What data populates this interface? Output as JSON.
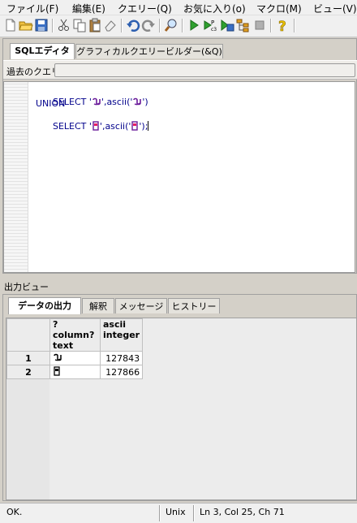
{
  "menu": {
    "items": [
      "ファイル(F)",
      "編集(E)",
      "クエリー(Q)",
      "お気に入り(o)",
      "マクロ(M)",
      "ビュー(V)"
    ]
  },
  "toolbar": {
    "icons": [
      "new-file-icon",
      "open-folder-icon",
      "save-icon",
      "cut-icon",
      "copy-icon",
      "paste-icon",
      "eraser-icon",
      "undo-icon",
      "redo-icon",
      "find-icon",
      "execute-icon",
      "explain-icon",
      "execute-to-file-icon",
      "explain-analyze-icon",
      "stop-icon",
      "help-icon"
    ]
  },
  "editor": {
    "tabs": [
      "SQLエディタ",
      "グラフィカルクエリービルダー(&Q)"
    ],
    "history_label": "過去のクエリ",
    "code": {
      "line1_pre": "SELECT '",
      "line1_mid": "',ascii('",
      "line1_post": "')",
      "line2": "UNION",
      "line3_pre": "SELECT '",
      "line3_mid": "',ascii('",
      "line3_post": "');"
    }
  },
  "output": {
    "label": "出力ビュー",
    "tabs": [
      "データの出力",
      "解釈",
      "メッセージ",
      "ヒストリー"
    ],
    "columns": [
      {
        "name": "?column?",
        "type": "text"
      },
      {
        "name": "ascii",
        "type": "integer"
      }
    ],
    "rows": [
      {
        "num": "1",
        "ascii": "127843"
      },
      {
        "num": "2",
        "ascii": "127866"
      }
    ]
  },
  "status": {
    "message": "OK.",
    "line_ending": "Unix",
    "position": "Ln 3, Col 25, Ch 71"
  },
  "colors": {
    "sql_text": "#00008b",
    "glyph_purple": "#6a1b9a"
  }
}
